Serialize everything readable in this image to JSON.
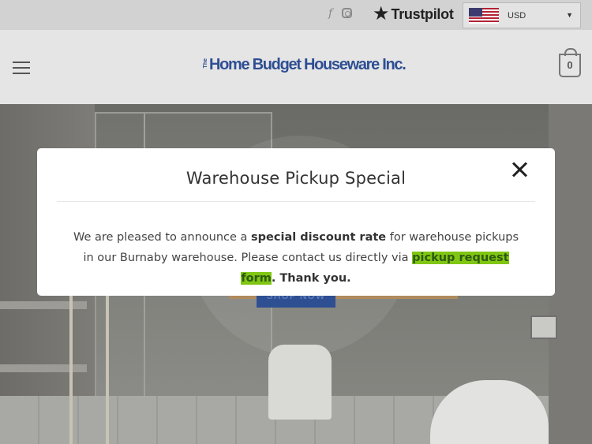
{
  "topbar": {
    "facebook_glyph": "f",
    "trustpilot": "Trustpilot",
    "currency": {
      "selected": "USD",
      "flag": "US"
    }
  },
  "header": {
    "logo_prefix": "The",
    "logo_text": "Home Budget Houseware Inc.",
    "cart_count": "0"
  },
  "hero": {
    "button_label": "SHOP NOW"
  },
  "modal": {
    "title": "Warehouse Pickup Special",
    "body_part1": "We are pleased to announce a ",
    "body_bold": "special discount rate",
    "body_part2": " for warehouse pickups in our Burnaby warehouse. Please contact us directly via ",
    "body_link": "pickup request form",
    "body_part3": ". Thank you."
  },
  "colors": {
    "brand": "#2f4f93",
    "highlight": "#80c613",
    "overlay": "#5a5a5a"
  },
  "icons": [
    "facebook-icon",
    "instagram-icon",
    "trustpilot-star-icon",
    "us-flag-icon",
    "chevron-down-icon",
    "hamburger-menu-icon",
    "cart-icon",
    "close-icon"
  ]
}
